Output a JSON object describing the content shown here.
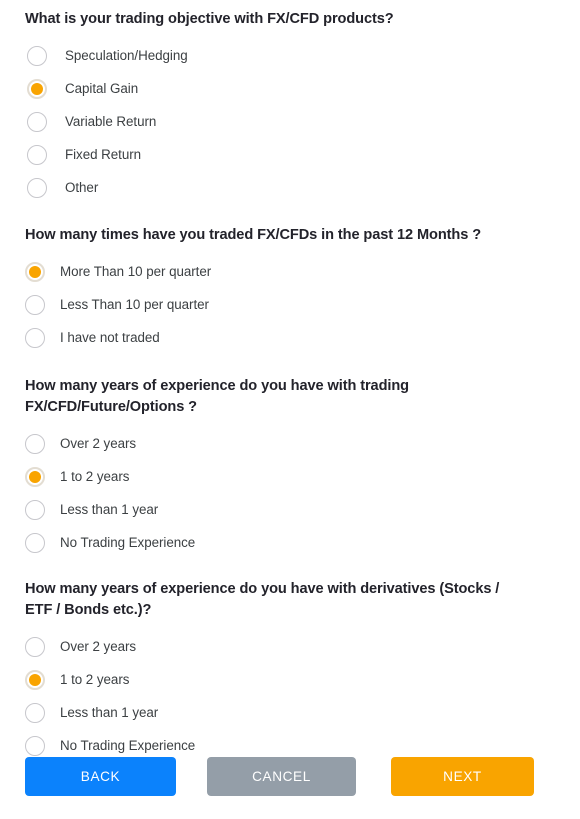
{
  "colors": {
    "accent_orange": "#f9a400",
    "primary_blue": "#0b82fc",
    "neutral_gray": "#949ea8",
    "heading_text": "#23232b",
    "label_text": "#3c4043",
    "radio_border": "#c7c7cc",
    "radio_selected_ring": "#e3ddd2"
  },
  "questions": [
    {
      "title": "What is your trading objective with FX/CFD products?",
      "options": [
        {
          "label": "Speculation/Hedging",
          "selected": false
        },
        {
          "label": "Capital Gain",
          "selected": true
        },
        {
          "label": "Variable Return",
          "selected": false
        },
        {
          "label": "Fixed Return",
          "selected": false
        },
        {
          "label": "Other",
          "selected": false
        }
      ]
    },
    {
      "title": "How many times have you traded FX/CFDs in the past 12 Months ?",
      "options": [
        {
          "label": "More Than 10 per quarter",
          "selected": true
        },
        {
          "label": "Less Than 10 per quarter",
          "selected": false
        },
        {
          "label": "I have not traded",
          "selected": false
        }
      ]
    },
    {
      "title": "How many years of experience do you have with trading FX/CFD/Future/Options ?",
      "options": [
        {
          "label": "Over 2 years",
          "selected": false
        },
        {
          "label": "1 to 2 years",
          "selected": true
        },
        {
          "label": "Less than 1 year",
          "selected": false
        },
        {
          "label": "No Trading Experience",
          "selected": false
        }
      ]
    },
    {
      "title": "How many years of experience do you have with derivatives (Stocks / ETF / Bonds etc.)?",
      "options": [
        {
          "label": "Over 2 years",
          "selected": false
        },
        {
          "label": "1 to 2 years",
          "selected": true
        },
        {
          "label": "Less than 1 year",
          "selected": false
        },
        {
          "label": "No Trading Experience",
          "selected": false
        }
      ]
    }
  ],
  "actions": {
    "back_label": "BACK",
    "cancel_label": "CANCEL",
    "next_label": "NEXT"
  }
}
